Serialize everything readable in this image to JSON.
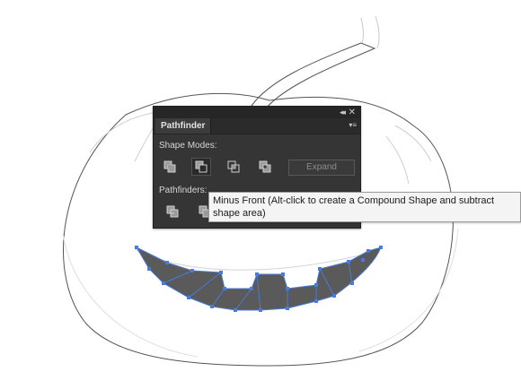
{
  "panel": {
    "tab_label": "Pathfinder",
    "collapse_icon": "double-chevron-left-icon",
    "close_icon": "close-icon",
    "menu_icon": "panel-menu-icon",
    "shape_modes_label": "Shape Modes:",
    "shape_modes": [
      {
        "icon": "unite-icon",
        "active": false
      },
      {
        "icon": "minus-front-icon",
        "active": true
      },
      {
        "icon": "intersect-icon",
        "active": false
      },
      {
        "icon": "exclude-icon",
        "active": false
      }
    ],
    "expand_label": "Expand",
    "pathfinders_label": "Pathfinders:",
    "pathfinders": [
      {
        "icon": "divide-icon"
      },
      {
        "icon": "trim-icon"
      }
    ]
  },
  "tooltip": {
    "line1": "Minus Front (Alt-click to create a Compound Shape and subtract",
    "line2": "shape area)"
  },
  "colors": {
    "panel_bg": "#353535",
    "selection": "#4a7bd8",
    "mouth_fill": "#5a5a5a",
    "outline": "#666666"
  }
}
